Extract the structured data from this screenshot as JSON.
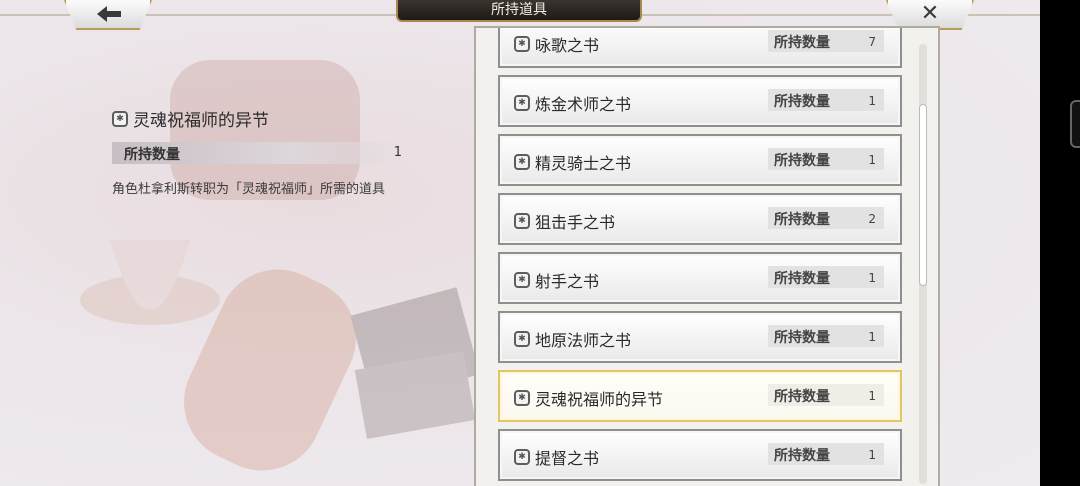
{
  "header": {
    "title": "所持道具"
  },
  "detail": {
    "name": "灵魂祝福师的异节",
    "count_label": "所持数量",
    "count_value": "1",
    "description": "角色杜拿利斯转职为「灵魂祝福师」所需的道具"
  },
  "items": [
    {
      "name": "咏歌之书",
      "count_label": "所持数量",
      "count": "7",
      "selected": false
    },
    {
      "name": "炼金术师之书",
      "count_label": "所持数量",
      "count": "1",
      "selected": false
    },
    {
      "name": "精灵骑士之书",
      "count_label": "所持数量",
      "count": "1",
      "selected": false
    },
    {
      "name": "狙击手之书",
      "count_label": "所持数量",
      "count": "2",
      "selected": false
    },
    {
      "name": "射手之书",
      "count_label": "所持数量",
      "count": "1",
      "selected": false
    },
    {
      "name": "地原法师之书",
      "count_label": "所持数量",
      "count": "1",
      "selected": false
    },
    {
      "name": "灵魂祝福师的异节",
      "count_label": "所持数量",
      "count": "1",
      "selected": true
    },
    {
      "name": "提督之书",
      "count_label": "所持数量",
      "count": "1",
      "selected": false
    }
  ],
  "icons": {
    "back": "arrow-left-icon",
    "close": "close-icon",
    "item": "book-icon"
  },
  "colors": {
    "selected_border": "#e3c46a",
    "title_bg": "#2b2520"
  }
}
